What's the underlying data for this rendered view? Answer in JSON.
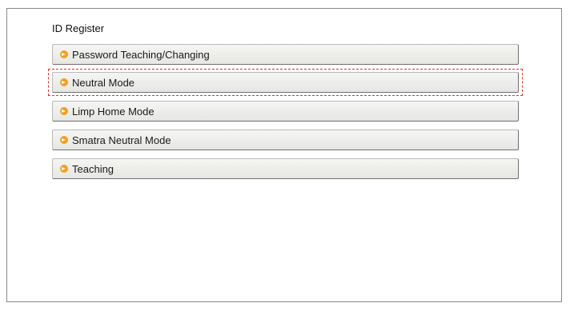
{
  "page": {
    "title": "ID Register"
  },
  "menu": {
    "items": [
      {
        "label": "Password Teaching/Changing",
        "icon": "arrow-right-circle-icon"
      },
      {
        "label": "Neutral Mode",
        "icon": "arrow-right-circle-icon",
        "highlighted": true
      },
      {
        "label": "Limp Home Mode",
        "icon": "arrow-right-circle-icon"
      },
      {
        "label": "Smatra Neutral Mode",
        "icon": "arrow-right-circle-icon"
      },
      {
        "label": "Teaching",
        "icon": "arrow-right-circle-icon"
      }
    ]
  },
  "colors": {
    "bullet": "#f0a020",
    "highlight": "#d9342b",
    "frame_border": "#8a8a8a"
  }
}
